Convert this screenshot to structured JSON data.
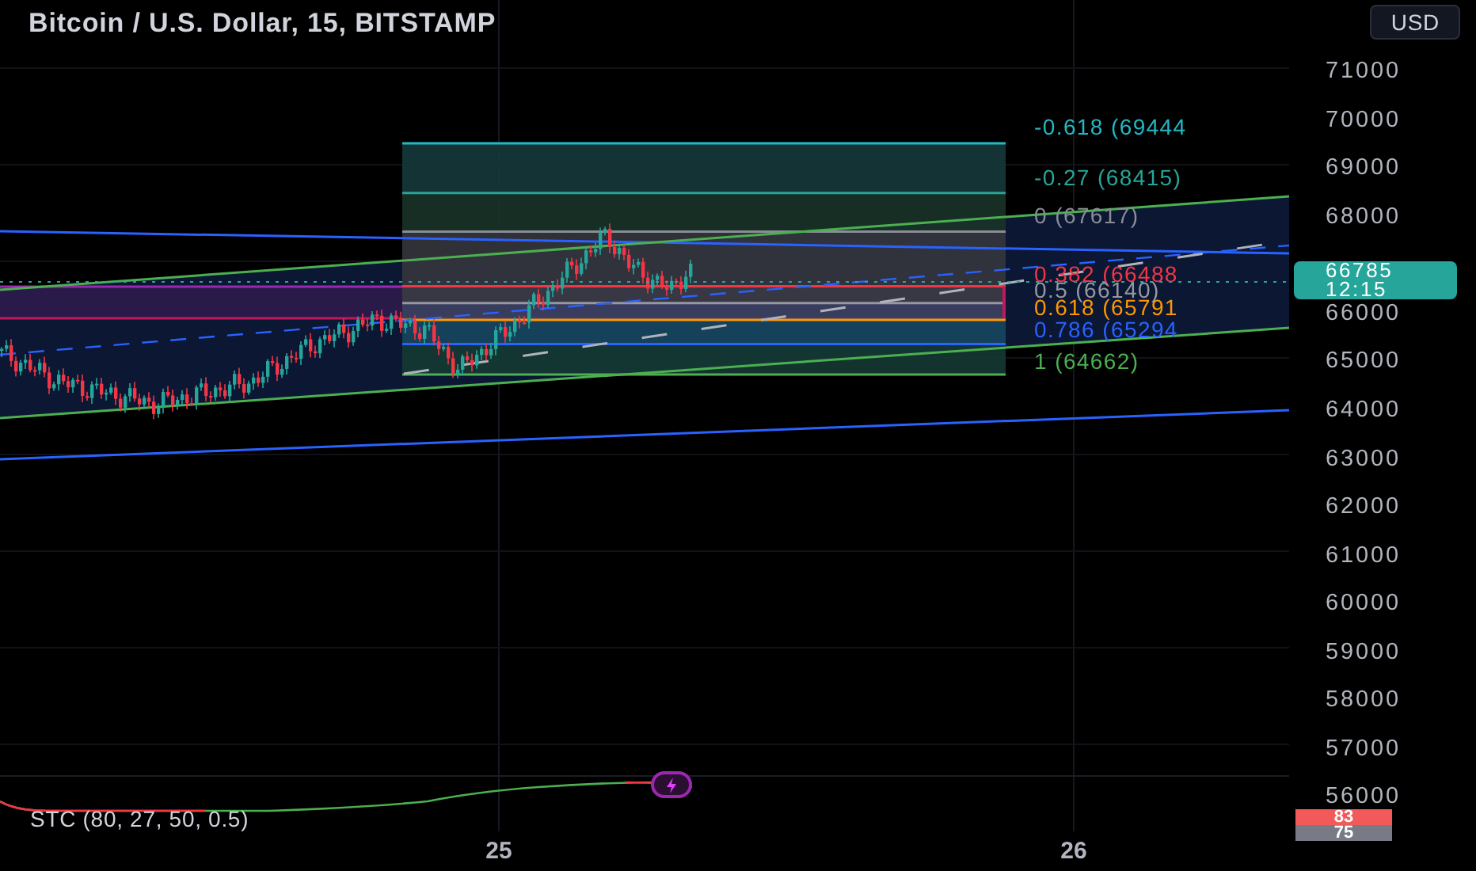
{
  "header": {
    "title": "Bitcoin / U.S. Dollar, 15, BITSTAMP",
    "currency_button": "USD"
  },
  "price_axis": [
    "71000",
    "70000",
    "69000",
    "68000",
    "66000",
    "65000",
    "64000",
    "63000",
    "62000",
    "61000",
    "60000",
    "59000",
    "58000",
    "57000",
    "56000"
  ],
  "last_price": {
    "price": "66785",
    "countdown": "12:15"
  },
  "fib_levels": [
    {
      "label": "-0.618 (69444",
      "color": "#22b8c4"
    },
    {
      "label": "-0.27 (68415)",
      "color": "#26a69a"
    },
    {
      "label": "0 (67617)",
      "color": "#8a8d96"
    },
    {
      "label": "0.382 (66488",
      "color": "#f23645"
    },
    {
      "label": "0.5 (66140)",
      "color": "#9598a1"
    },
    {
      "label": "0.618 (65791",
      "color": "#ff9800"
    },
    {
      "label": "0.786 (65294",
      "color": "#2962ff"
    },
    {
      "label": "1 (64662)",
      "color": "#4caf50"
    }
  ],
  "indicator": {
    "label": "STC (80, 27, 50, 0.5)",
    "values": [
      {
        "text": "83",
        "color": "#f25a5a"
      },
      {
        "text": "75",
        "color": "#787b86"
      }
    ]
  },
  "time_axis": [
    "25",
    "26"
  ]
}
